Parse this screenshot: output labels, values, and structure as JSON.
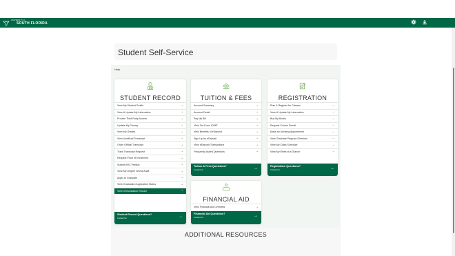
{
  "header": {
    "brand_sup": "UNIVERSITY of",
    "brand_main": "SOUTH FLORIDA",
    "icons": [
      "gear-icon",
      "download-icon"
    ],
    "color": "#006747"
  },
  "page": {
    "title": "Student Self-Service",
    "help": "Help"
  },
  "cards": {
    "student_record": {
      "title": "STUDENT RECORD",
      "icon": "student-record-icon",
      "items": [
        {
          "label": "View My Student Profile"
        },
        {
          "label": "View & Update My Information"
        },
        {
          "label": "Provide Third Party Access"
        },
        {
          "label": "Update My Privacy"
        },
        {
          "label": "View My Grades"
        },
        {
          "label": "View Unofficial Transcript"
        },
        {
          "label": "Order Official Transcript"
        },
        {
          "label": "Track Transcript Request"
        },
        {
          "label": "Request Proof of Enrollment"
        },
        {
          "label": "Submit ARC Petition"
        },
        {
          "label": "View My Degree Works Audit"
        },
        {
          "label": "Apply to Graduate"
        },
        {
          "label": "View Graduation Application Status"
        },
        {
          "label": "View Immunization Record"
        }
      ],
      "question": "Student Record Questions?",
      "contact": "Contact Us"
    },
    "tuition": {
      "title": "TUITION & FEES",
      "icon": "tuition-icon",
      "items": [
        {
          "label": "Account Summary"
        },
        {
          "label": "Account Detail"
        },
        {
          "label": "Pay My Bill"
        },
        {
          "label": "View Tax Form 1098T"
        },
        {
          "label": "View Benefits of eDeposit"
        },
        {
          "label": "Sign Up for eDeposit"
        },
        {
          "label": "View eDeposit Transactions"
        },
        {
          "label": "Frequently Asked Questions"
        }
      ],
      "question": "Tuition & Fees Questions?",
      "contact": "Contact Us"
    },
    "registration": {
      "title": "REGISTRATION",
      "icon": "registration-icon",
      "items": [
        {
          "label": "Plan & Register for Classes"
        },
        {
          "label": "View & Update My Information"
        },
        {
          "label": "Buy My Books"
        },
        {
          "label": "Request Course Permit"
        },
        {
          "label": "Make an Advising Appointment"
        },
        {
          "label": "View Graduate Program Directors"
        },
        {
          "label": "View My Class Schedule"
        },
        {
          "label": "View My Week at a Glance"
        }
      ],
      "question": "Registration Questions?",
      "contact": "Contact Us"
    },
    "financial_aid": {
      "title": "FINANCIAL AID",
      "icon": "financial-aid-icon",
      "items": [
        {
          "label": "View Financial Aid Overview"
        }
      ],
      "question": "Financial Aid Questions?",
      "contact": "Contact Us"
    }
  },
  "additional": {
    "title": "ADDITIONAL RESOURCES"
  }
}
